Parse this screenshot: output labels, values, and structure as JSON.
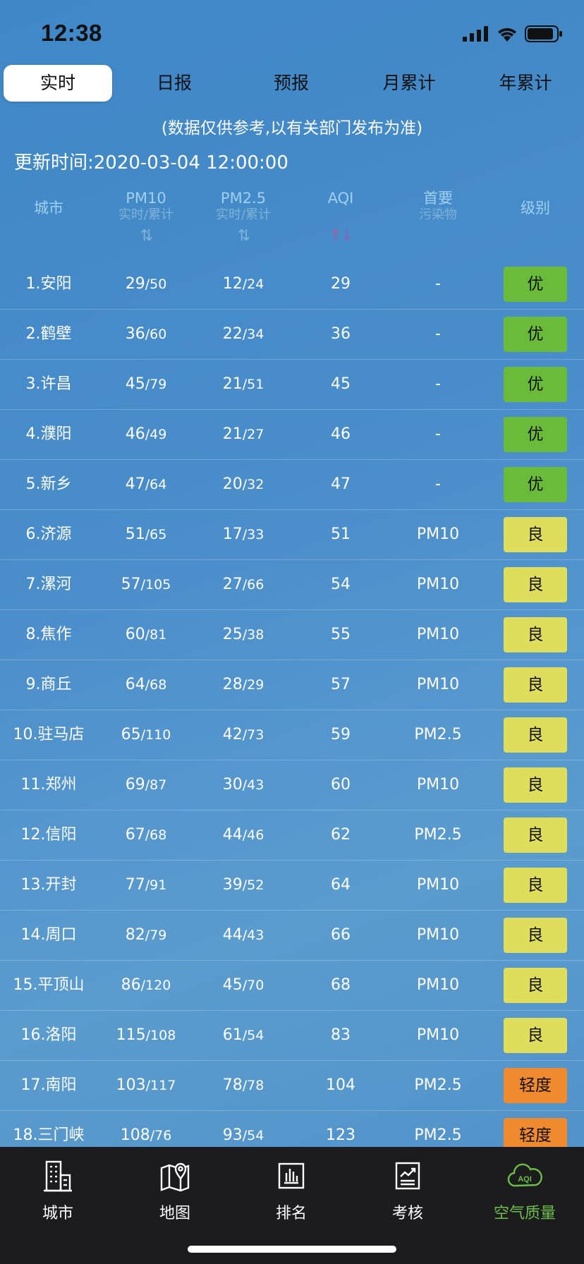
{
  "status": {
    "time": "12:38"
  },
  "tabs": [
    "实时",
    "日报",
    "预报",
    "月累计",
    "年累计"
  ],
  "disclaimer": "(数据仅供参考,以有关部门发布为准)",
  "update_time": "更新时间:2020-03-04 12:00:00",
  "columns": {
    "city": "城市",
    "pm10": "PM10",
    "pm10_sub": "实时/累计",
    "pm25": "PM2.5",
    "pm25_sub": "实时/累计",
    "aqi": "AQI",
    "primary": "首要",
    "primary_sub": "污染物",
    "level": "级别",
    "sort_symbol": "⇅"
  },
  "rows": [
    {
      "city": "1.安阳",
      "pm10_rt": "29",
      "pm10_cum": "/50",
      "pm25_rt": "12",
      "pm25_cum": "/24",
      "aqi": "29",
      "primary": "-",
      "level": "优",
      "color": "g"
    },
    {
      "city": "2.鹤壁",
      "pm10_rt": "36",
      "pm10_cum": "/60",
      "pm25_rt": "22",
      "pm25_cum": "/34",
      "aqi": "36",
      "primary": "-",
      "level": "优",
      "color": "g"
    },
    {
      "city": "3.许昌",
      "pm10_rt": "45",
      "pm10_cum": "/79",
      "pm25_rt": "21",
      "pm25_cum": "/51",
      "aqi": "45",
      "primary": "-",
      "level": "优",
      "color": "g"
    },
    {
      "city": "4.濮阳",
      "pm10_rt": "46",
      "pm10_cum": "/49",
      "pm25_rt": "21",
      "pm25_cum": "/27",
      "aqi": "46",
      "primary": "-",
      "level": "优",
      "color": "g"
    },
    {
      "city": "5.新乡",
      "pm10_rt": "47",
      "pm10_cum": "/64",
      "pm25_rt": "20",
      "pm25_cum": "/32",
      "aqi": "47",
      "primary": "-",
      "level": "优",
      "color": "g"
    },
    {
      "city": "6.济源",
      "pm10_rt": "51",
      "pm10_cum": "/65",
      "pm25_rt": "17",
      "pm25_cum": "/33",
      "aqi": "51",
      "primary": "PM10",
      "level": "良",
      "color": "y"
    },
    {
      "city": "7.漯河",
      "pm10_rt": "57",
      "pm10_cum": "/105",
      "pm25_rt": "27",
      "pm25_cum": "/66",
      "aqi": "54",
      "primary": "PM10",
      "level": "良",
      "color": "y"
    },
    {
      "city": "8.焦作",
      "pm10_rt": "60",
      "pm10_cum": "/81",
      "pm25_rt": "25",
      "pm25_cum": "/38",
      "aqi": "55",
      "primary": "PM10",
      "level": "良",
      "color": "y"
    },
    {
      "city": "9.商丘",
      "pm10_rt": "64",
      "pm10_cum": "/68",
      "pm25_rt": "28",
      "pm25_cum": "/29",
      "aqi": "57",
      "primary": "PM10",
      "level": "良",
      "color": "y"
    },
    {
      "city": "10.驻马店",
      "pm10_rt": "65",
      "pm10_cum": "/110",
      "pm25_rt": "42",
      "pm25_cum": "/73",
      "aqi": "59",
      "primary": "PM2.5",
      "level": "良",
      "color": "y"
    },
    {
      "city": "11.郑州",
      "pm10_rt": "69",
      "pm10_cum": "/87",
      "pm25_rt": "30",
      "pm25_cum": "/43",
      "aqi": "60",
      "primary": "PM10",
      "level": "良",
      "color": "y"
    },
    {
      "city": "12.信阳",
      "pm10_rt": "67",
      "pm10_cum": "/68",
      "pm25_rt": "44",
      "pm25_cum": "/46",
      "aqi": "62",
      "primary": "PM2.5",
      "level": "良",
      "color": "y"
    },
    {
      "city": "13.开封",
      "pm10_rt": "77",
      "pm10_cum": "/91",
      "pm25_rt": "39",
      "pm25_cum": "/52",
      "aqi": "64",
      "primary": "PM10",
      "level": "良",
      "color": "y"
    },
    {
      "city": "14.周口",
      "pm10_rt": "82",
      "pm10_cum": "/79",
      "pm25_rt": "44",
      "pm25_cum": "/43",
      "aqi": "66",
      "primary": "PM10",
      "level": "良",
      "color": "y"
    },
    {
      "city": "15.平顶山",
      "pm10_rt": "86",
      "pm10_cum": "/120",
      "pm25_rt": "45",
      "pm25_cum": "/70",
      "aqi": "68",
      "primary": "PM10",
      "level": "良",
      "color": "y"
    },
    {
      "city": "16.洛阳",
      "pm10_rt": "115",
      "pm10_cum": "/108",
      "pm25_rt": "61",
      "pm25_cum": "/54",
      "aqi": "83",
      "primary": "PM10",
      "level": "良",
      "color": "y"
    },
    {
      "city": "17.南阳",
      "pm10_rt": "103",
      "pm10_cum": "/117",
      "pm25_rt": "78",
      "pm25_cum": "/78",
      "aqi": "104",
      "primary": "PM2.5",
      "level": "轻度",
      "color": "o"
    },
    {
      "city": "18.三门峡",
      "pm10_rt": "108",
      "pm10_cum": "/76",
      "pm25_rt": "93",
      "pm25_cum": "/54",
      "aqi": "123",
      "primary": "PM2.5",
      "level": "轻度",
      "color": "o"
    }
  ],
  "nav": [
    {
      "label": "城市",
      "icon": "building-icon"
    },
    {
      "label": "地图",
      "icon": "map-pin-icon"
    },
    {
      "label": "排名",
      "icon": "bar-chart-icon"
    },
    {
      "label": "考核",
      "icon": "report-chart-icon"
    },
    {
      "label": "空气质量",
      "icon": "aqi-cloud-icon"
    }
  ],
  "colors": {
    "good": "#6abb3a",
    "moderate": "#dedd5c",
    "light": "#f08a2f",
    "nav_active": "#6bbf47"
  }
}
